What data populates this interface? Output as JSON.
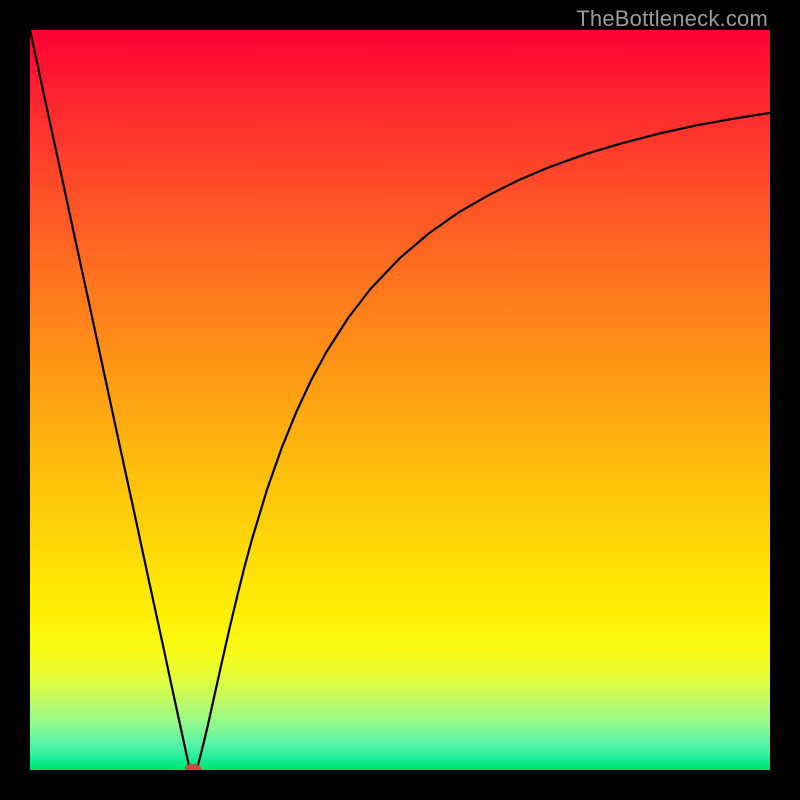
{
  "attribution": "TheBottleneck.com",
  "colors": {
    "frame": "#000000",
    "curve": "#000000",
    "marker": "#cc4b3e",
    "gradient_top": "#ff0033",
    "gradient_bottom": "#00e060"
  },
  "chart_data": {
    "type": "line",
    "title": "",
    "xlabel": "",
    "ylabel": "",
    "xlim": [
      0,
      100
    ],
    "ylim": [
      0,
      100
    ],
    "annotations": [],
    "marker": {
      "x": 22,
      "y": 0
    },
    "series": [
      {
        "name": "left-segment",
        "x": [
          0,
          2,
          4,
          6,
          8,
          10,
          12,
          14,
          16,
          18,
          19,
          20,
          20.8,
          21.3,
          21.6
        ],
        "values": [
          100,
          90.7,
          81.5,
          72.2,
          63.0,
          53.7,
          44.4,
          35.2,
          25.9,
          16.7,
          12.0,
          7.4,
          3.7,
          1.4,
          0.0
        ]
      },
      {
        "name": "right-segment",
        "x": [
          22.5,
          23,
          23.5,
          24,
          25,
          26,
          27,
          28,
          29,
          30,
          32,
          34,
          36,
          38,
          40,
          43,
          46,
          50,
          54,
          58,
          62,
          66,
          70,
          75,
          80,
          85,
          90,
          95,
          100
        ],
        "values": [
          0.0,
          1.8,
          3.8,
          5.9,
          10.4,
          14.9,
          19.3,
          23.5,
          27.5,
          31.2,
          37.8,
          43.5,
          48.4,
          52.7,
          56.4,
          61.1,
          65.0,
          69.2,
          72.6,
          75.4,
          77.7,
          79.7,
          81.4,
          83.2,
          84.7,
          86.0,
          87.1,
          88.0,
          88.8
        ]
      }
    ]
  }
}
